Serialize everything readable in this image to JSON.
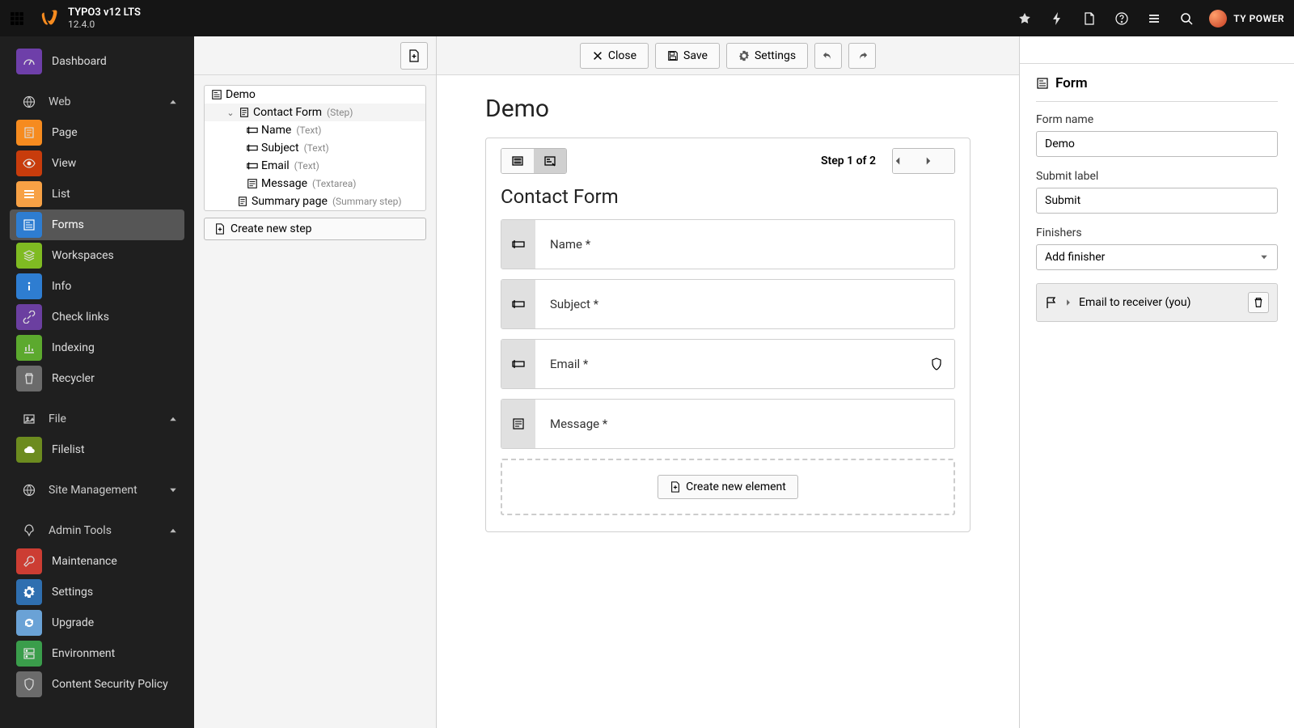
{
  "topbar": {
    "product": "TYPO3 v12 LTS",
    "version": "12.4.0",
    "user": "TY POWER"
  },
  "sidebar": {
    "dashboard": "Dashboard",
    "sections": {
      "web": "Web",
      "file": "File",
      "site": "Site Management",
      "admin": "Admin Tools"
    },
    "items": {
      "page": "Page",
      "view": "View",
      "list": "List",
      "forms": "Forms",
      "workspaces": "Workspaces",
      "info": "Info",
      "checklinks": "Check links",
      "indexing": "Indexing",
      "recycler": "Recycler",
      "filelist": "Filelist",
      "maintenance": "Maintenance",
      "settings": "Settings",
      "upgrade": "Upgrade",
      "environment": "Environment",
      "csp": "Content Security Policy"
    }
  },
  "tree": {
    "root": "Demo",
    "step": "Contact Form",
    "step_type": "(Step)",
    "fields": [
      {
        "label": "Name",
        "type": "(Text)"
      },
      {
        "label": "Subject",
        "type": "(Text)"
      },
      {
        "label": "Email",
        "type": "(Text)"
      },
      {
        "label": "Message",
        "type": "(Textarea)"
      }
    ],
    "summary": "Summary page",
    "summary_type": "(Summary step)",
    "create_step": "Create new step"
  },
  "toolbar": {
    "close": "Close",
    "save": "Save",
    "settings": "Settings"
  },
  "editor": {
    "heading": "Demo",
    "step_indicator": "Step 1 of 2",
    "step_title": "Contact Form",
    "fields": [
      {
        "label": "Name *",
        "icon": "text"
      },
      {
        "label": "Subject *",
        "icon": "text"
      },
      {
        "label": "Email *",
        "icon": "text",
        "shield": true
      },
      {
        "label": "Message *",
        "icon": "textarea"
      }
    ],
    "create_element": "Create new element"
  },
  "inspector": {
    "title": "Form",
    "form_name_label": "Form name",
    "form_name_value": "Demo",
    "submit_label_label": "Submit label",
    "submit_label_value": "Submit",
    "finishers_label": "Finishers",
    "add_finisher": "Add finisher",
    "finisher_item": "Email to receiver (you)"
  }
}
